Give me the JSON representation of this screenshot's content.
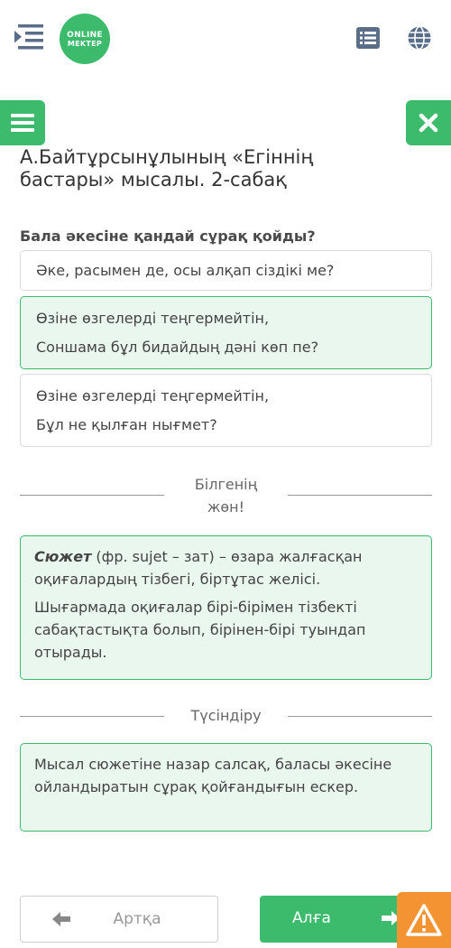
{
  "header": {
    "logo_line1": "ONLINE",
    "logo_line2": "MEKTEP",
    "icons": [
      "menu-expand-icon",
      "list-icon",
      "globe-icon",
      "hamburger-icon",
      "close-icon"
    ],
    "accent_color": "#3dbb6d"
  },
  "lesson": {
    "title": "А.Байтұрсынұлының «Егіннің бастары» мысалы. 2-сабақ"
  },
  "quiz": {
    "question": "Бала әкесіне қандай сұрақ қойды?",
    "options": [
      {
        "lines": [
          "Әке, расымен де, осы алқап сіздікі ме?"
        ],
        "selected": false
      },
      {
        "lines": [
          "Өзіне өзгелерді теңгермейтін,",
          "Соншама бұл бидайдың дәні көп пе?"
        ],
        "selected": true
      },
      {
        "lines": [
          "Өзіне өзгелерді теңгермейтін,",
          "Бұл не қылған нығмет?"
        ],
        "selected": false
      }
    ]
  },
  "knowledge": {
    "heading_line1": "Білгенің",
    "heading_line2": "жөн!",
    "term": "Сюжет",
    "definition": " (фр. sujet – зат) – өзара жалғасқан оқиғалардың тізбегі, біртұтас желісі.",
    "paragraph2": "Шығармада оқиғалар бірі-бірімен тізбекті сабақтастықта болып, бірінен-бірі туындап отырады."
  },
  "explanation": {
    "heading": "Түсіндіру",
    "text": "Мысал сюжетіне назар салсақ, баласы әкесіне ойландыратын сұрақ қойғандығын ескер."
  },
  "navigation": {
    "back_label": "Артқа",
    "next_label": "Алға",
    "warning_icon": "warning-icon",
    "warning_color": "#f39332"
  }
}
